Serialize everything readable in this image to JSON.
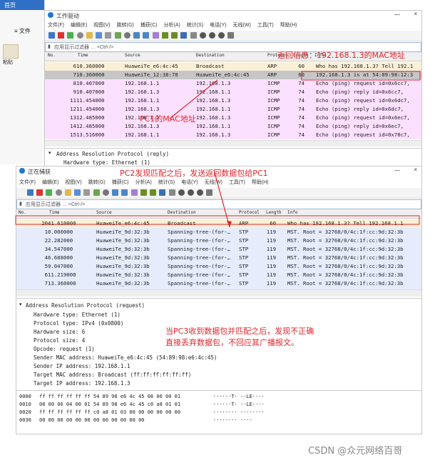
{
  "win1": {
    "title": "工作驱动",
    "menu": [
      "文件(F)",
      "编辑(E)",
      "视图(V)",
      "跳转(G)",
      "捕获(C)",
      "分析(A)",
      "统计(S)",
      "电话(Y)",
      "无线(W)",
      "工具(T)",
      "帮助(H)"
    ],
    "filter_placeholder": "应用显示过滤器 … <Ctrl-/>",
    "columns": [
      "No.",
      "Time",
      "Source",
      "Destination",
      "Protocol",
      "Length",
      "Info"
    ],
    "rows": [
      {
        "no": "6",
        "time": "10.360000",
        "src": "HuaweiTe_e6:4c:45",
        "dst": "Broadcast",
        "proto": "ARP",
        "len": "60",
        "info": "Who has 192.168.1.3? Tell 192.1",
        "cls": "arp"
      },
      {
        "no": "7",
        "time": "10.360000",
        "src": "HuaweiTe_12:38:78",
        "dst": "HuaweiTe_e6:4c:45",
        "proto": "ARP",
        "len": "60",
        "info": "192.168.1.3 is at 54:89:98:12:3",
        "cls": "sel"
      },
      {
        "no": "8",
        "time": "10.407000",
        "src": "192.168.1.1",
        "dst": "192.168.1.3",
        "proto": "ICMP",
        "len": "74",
        "info": "Echo (ping) request  id=0x6cc7,",
        "cls": "icmp"
      },
      {
        "no": "9",
        "time": "10.407000",
        "src": "192.168.1.3",
        "dst": "192.168.1.1",
        "proto": "ICMP",
        "len": "74",
        "info": "Echo (ping) reply    id=0x6cc7,",
        "cls": "icmp"
      },
      {
        "no": "11",
        "time": "11.454000",
        "src": "192.168.1.1",
        "dst": "192.168.1.3",
        "proto": "ICMP",
        "len": "74",
        "info": "Echo (ping) request  id=0x6dc7,",
        "cls": "icmp"
      },
      {
        "no": "12",
        "time": "11.454000",
        "src": "192.168.1.3",
        "dst": "192.168.1.1",
        "proto": "ICMP",
        "len": "74",
        "info": "Echo (ping) reply    id=0x6dc7,",
        "cls": "icmp"
      },
      {
        "no": "13",
        "time": "12.485000",
        "src": "192.168.1.1",
        "dst": "192.168.1.3",
        "proto": "ICMP",
        "len": "74",
        "info": "Echo (ping) request  id=0x6ec7,",
        "cls": "icmp"
      },
      {
        "no": "14",
        "time": "12.485000",
        "src": "192.168.1.3",
        "dst": "192.168.1.1",
        "proto": "ICMP",
        "len": "74",
        "info": "Echo (ping) reply    id=0x6ec7,",
        "cls": "icmp"
      },
      {
        "no": "15",
        "time": "13.516000",
        "src": "192.168.1.1",
        "dst": "192.168.1.3",
        "proto": "ICMP",
        "len": "74",
        "info": "Echo (ping) request  id=0x70c7,",
        "cls": "icmp"
      }
    ],
    "detail": [
      "Address Resolution Protocol (reply)",
      "Hardware type: Ethernet (1)"
    ]
  },
  "sidebar": {
    "tab": "首页",
    "file": "文件",
    "paste": "粘贴"
  },
  "win2": {
    "title": "正在捕获",
    "menu": [
      "文件(F)",
      "编辑(E)",
      "视图(V)",
      "跳转(G)",
      "捕获(C)",
      "分析(A)",
      "统计(S)",
      "电话(Y)",
      "无线(W)",
      "工具(T)",
      "帮助(H)"
    ],
    "filter_placeholder": "应用显示过滤器 … <Ctrl-/>",
    "columns": [
      "No.",
      "Time",
      "Source",
      "Destination",
      "Protocol",
      "Length",
      "Info"
    ],
    "rows": [
      {
        "no": "20",
        "time": "41.610000",
        "src": "HuaweiTe_e6:4c:45",
        "dst": "Broadcast",
        "proto": "ARP",
        "len": "60",
        "info": "Who has 192.168.1.3? Tell 192.168.1.1",
        "cls": "arp"
      },
      {
        "no": "1",
        "time": "0.000000",
        "src": "HuaweiTe_9d:32:3b",
        "dst": "Spanning-tree-(for-…",
        "proto": "STP",
        "len": "119",
        "info": "MST. Root = 32768/0/4c:1f:cc:9d:32:3b",
        "cls": "stp"
      },
      {
        "no": "2",
        "time": "2.282000",
        "src": "HuaweiTe_9d:32:3b",
        "dst": "Spanning-tree-(for-…",
        "proto": "STP",
        "len": "119",
        "info": "MST. Root = 32768/0/4c:1f:cc:9d:32:3b",
        "cls": "stp"
      },
      {
        "no": "3",
        "time": "4.547000",
        "src": "HuaweiTe_9d:32:3b",
        "dst": "Spanning-tree-(for-…",
        "proto": "STP",
        "len": "119",
        "info": "MST. Root = 32768/0/4c:1f:cc:9d:32:3b",
        "cls": "stp"
      },
      {
        "no": "4",
        "time": "6.688000",
        "src": "HuaweiTe_9d:32:3b",
        "dst": "Spanning-tree-(for-…",
        "proto": "STP",
        "len": "119",
        "info": "MST. Root = 32768/0/4c:1f:cc:9d:32:3b",
        "cls": "stp"
      },
      {
        "no": "5",
        "time": "9.047000",
        "src": "HuaweiTe_9d:32:3b",
        "dst": "Spanning-tree-(for-…",
        "proto": "STP",
        "len": "119",
        "info": "MST. Root = 32768/0/4c:1f:cc:9d:32:3b",
        "cls": "stp"
      },
      {
        "no": "6",
        "time": "11.219000",
        "src": "HuaweiTe_9d:32:3b",
        "dst": "Spanning-tree-(for-…",
        "proto": "STP",
        "len": "119",
        "info": "MST. Root = 32768/0/4c:1f:cc:9d:32:3b",
        "cls": "stp"
      },
      {
        "no": "7",
        "time": "13.360000",
        "src": "HuaweiTe_9d:32:3b",
        "dst": "Spanning-tree-(for-…",
        "proto": "STP",
        "len": "119",
        "info": "MST. Root = 32768/0/4c:1f:cc:9d:32:3b",
        "cls": "stp"
      },
      {
        "no": "8",
        "time": "15.547000",
        "src": "HuaweiTe_9d:32:3b",
        "dst": "Spanning-tree-(for-…",
        "proto": "STP",
        "len": "119",
        "info": "MST. Root = 32768/0/4c:1f:cc:9d:32:3b",
        "cls": "stp"
      }
    ],
    "detail": [
      "Address Resolution Protocol (request)",
      "Hardware type: Ethernet (1)",
      "Protocol type: IPv4 (0x0800)",
      "Hardware size: 6",
      "Protocol size: 4",
      "Opcode: request (1)",
      "Sender MAC address: HuaweiTe_e6:4c:45 (54:89:98:e6:4c:45)",
      "Sender IP address: 192.168.1.1",
      "Target MAC address: Broadcast (ff:ff:ff:ff:ff:ff)",
      "Target IP address: 192.168.1.3"
    ],
    "hex": [
      {
        "off": "0000",
        "bytes": "ff ff ff ff ff ff 54 89  98 e6 4c 45 08 06 00 01",
        "ascii": "······T· ··LE····"
      },
      {
        "off": "0010",
        "bytes": "08 00 06 04 00 01 54 89  98 e6 4c 45 c0 a8 01 01",
        "ascii": "······T· ··LE····"
      },
      {
        "off": "0020",
        "bytes": "ff ff ff ff ff ff c0 a8  01 03 00 00 00 00 00 00",
        "ascii": "········ ········"
      },
      {
        "off": "0030",
        "bytes": "00 00 00 00 00 00 00 00  00 00 00 00",
        "ascii": "········ ····"
      }
    ]
  },
  "annotations": {
    "return_info": "返回信息：192.168.1.3的MAC地址",
    "pc1_mac": "PC1的MAC地址",
    "pc2_match": "PC2发现匹配之后，发送返回数据包给PC1",
    "pc3_line1": "当PC3收到数据包并匹配之后，发现不正确",
    "pc3_line2": "直接丢弃数据包，不回应其广播报文。"
  },
  "watermark": "CSDN @众元网络百哥"
}
